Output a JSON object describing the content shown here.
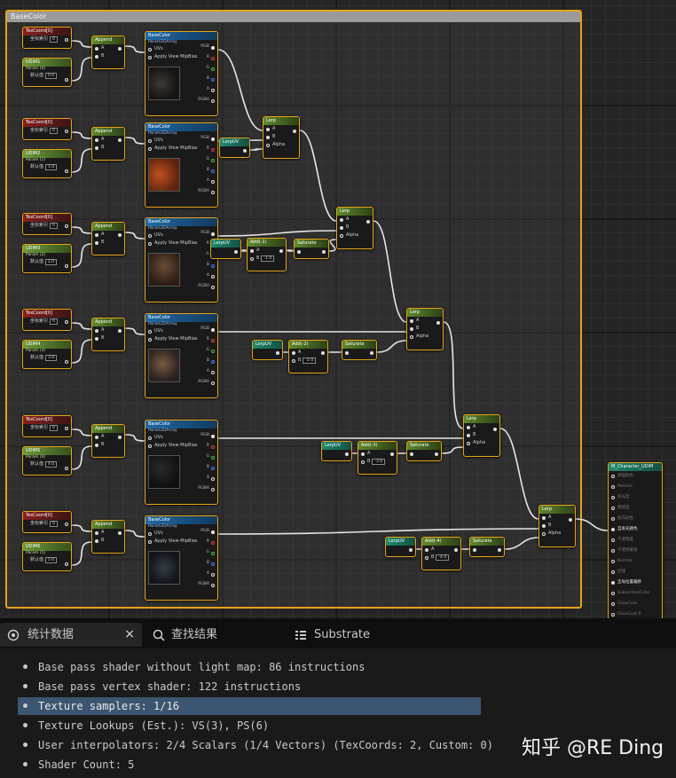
{
  "comment": {
    "title": "BaseColor"
  },
  "texcoord": {
    "title": "TexCoord[0]",
    "index_label": "坐标索引",
    "index_value": "0"
  },
  "udim_nodes": [
    {
      "title": "UDIM1",
      "param": "Param (0)",
      "default_label": "默认值",
      "default_value": "0.0"
    },
    {
      "title": "UDIM2",
      "param": "Param (1)",
      "default_label": "默认值",
      "default_value": "1.0"
    },
    {
      "title": "UDIM3",
      "param": "Param (2)",
      "default_label": "默认值",
      "default_value": "2.0"
    },
    {
      "title": "UDIM4",
      "param": "Param (3)",
      "default_label": "默认值",
      "default_value": "3.0"
    },
    {
      "title": "UDIM5",
      "param": "Param (4)",
      "default_label": "默认值",
      "default_value": "4.0"
    },
    {
      "title": "UDIM6",
      "param": "Param (5)",
      "default_label": "默认值",
      "default_value": "5.0"
    }
  ],
  "append": {
    "title": "Append",
    "a": "A",
    "b": "B"
  },
  "texture": {
    "title": "BaseColor",
    "subtitle": "Param2DArray",
    "uvs": "UVs",
    "mip": "Apply View MipBias",
    "outputs": [
      "RGB",
      "R",
      "G",
      "B",
      "A",
      "RGBA"
    ]
  },
  "lerp": {
    "title": "Lerp",
    "a": "A",
    "b": "B",
    "alpha": "Alpha"
  },
  "lerpuv": {
    "title": "LerpUV"
  },
  "add_nodes": [
    {
      "title": "Add(-1)",
      "a": "A",
      "b": "B",
      "b_value": "-1.0"
    },
    {
      "title": "Add(-2)",
      "a": "A",
      "b": "B",
      "b_value": "-2.0"
    },
    {
      "title": "Add(-3)",
      "a": "A",
      "b": "B",
      "b_value": "-3.0"
    },
    {
      "title": "Add(-4)",
      "a": "A",
      "b": "B",
      "b_value": "-4.0"
    }
  ],
  "saturate": {
    "title": "Saturate"
  },
  "material": {
    "title": "M_Character_UDIM",
    "pins": [
      {
        "label": "基础颜色",
        "active": false
      },
      {
        "label": "Metallic",
        "active": false
      },
      {
        "label": "高光度",
        "active": false
      },
      {
        "label": "粗糙度",
        "active": false
      },
      {
        "label": "各向异性",
        "active": false
      },
      {
        "label": "自发光颜色",
        "active": true
      },
      {
        "label": "不透明度",
        "active": false
      },
      {
        "label": "不透明蒙版",
        "active": false
      },
      {
        "label": "Normal",
        "active": false
      },
      {
        "label": "切线",
        "active": false
      },
      {
        "label": "全局位置偏移",
        "active": true
      },
      {
        "label": "SubsurfaceColor",
        "active": false
      },
      {
        "label": "ClearCoat",
        "active": false
      },
      {
        "label": "ClearCoat R",
        "active": false
      }
    ]
  },
  "tabs": {
    "stats": "统计数据",
    "close": "×",
    "find": "查找结果",
    "substrate": "Substrate"
  },
  "stats": [
    "Base pass shader without light map: 86 instructions",
    "Base pass vertex shader: 122 instructions",
    "Texture samplers: 1/16",
    "Texture Lookups (Est.): VS(3), PS(6)",
    "User interpolators: 2/4 Scalars (1/4 Vectors) (TexCoords: 2, Custom: 0)",
    "Shader Count: 5"
  ],
  "selected_stat_index": 2,
  "watermark": "知乎 @RE Ding",
  "colors": {
    "accent": "#e8a317",
    "selection": "#3c5570",
    "wire": "#e6e6e6"
  }
}
